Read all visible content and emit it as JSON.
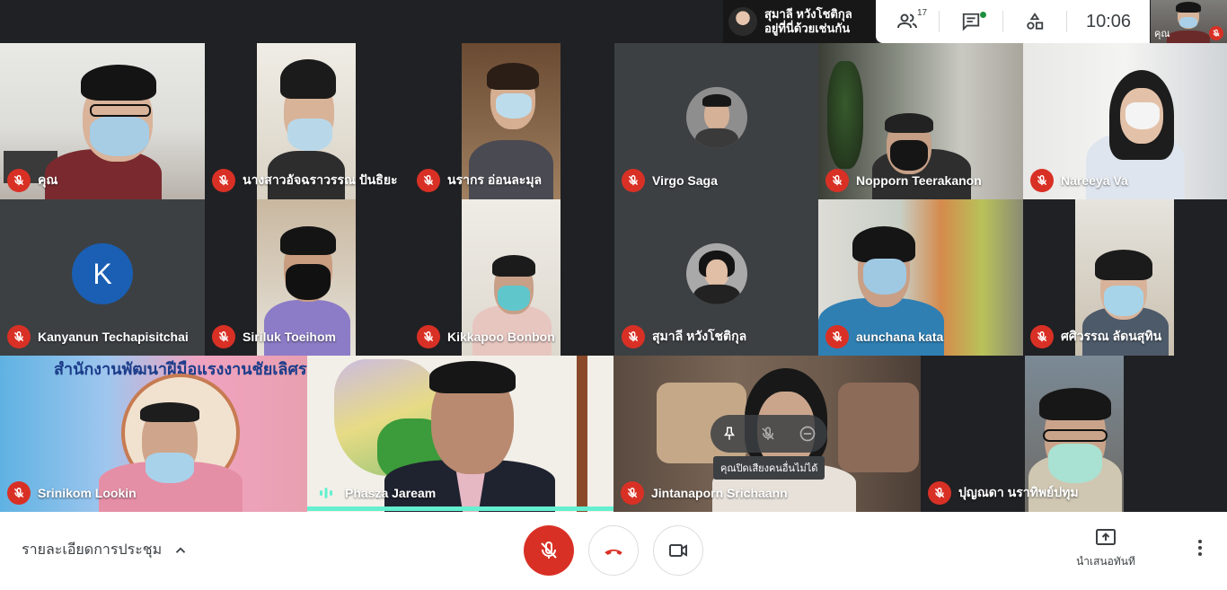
{
  "topbar": {
    "presenter_name": "สุมาลี หวังโชติกุล",
    "presenter_status": "อยู่ที่นี่ด้วยเช่นกัน",
    "participants_count": "17",
    "clock": "10:06",
    "self_label": "คุณ"
  },
  "tiles": [
    {
      "name": "คุณ"
    },
    {
      "name": "นางสาวอัจฉราวรรณ ปันธิยะ"
    },
    {
      "name": "นรากร อ่อนละมุล"
    },
    {
      "name": "Virgo Saga"
    },
    {
      "name": "Nopporn Teerakanon"
    },
    {
      "name": "Nareeya Va"
    },
    {
      "name": "Kanyanun Techapisitchai",
      "initial": "K"
    },
    {
      "name": "Siriluk Toeihom"
    },
    {
      "name": "Kikkapoo Bonbon"
    },
    {
      "name": "สุมาลี หวังโชติกุล"
    },
    {
      "name": "aunchana kata"
    },
    {
      "name": "ศศิวรรณ ลัดนสุทิน"
    },
    {
      "name": "Srinikom Lookin",
      "banner": "สำนักงานพัฒนาฝีมือแรงงานชัยเลิศร"
    },
    {
      "name": "Phasza Jaream"
    },
    {
      "name": "Jintanaporn Srichaann"
    },
    {
      "name": "ปุญณดา นราทิพย์ปทุม"
    }
  ],
  "hover_tooltip": "คุณปิดเสียงคนอื่นไม่ได้",
  "bottombar": {
    "meeting_details": "รายละเอียดการประชุม",
    "present_now": "นำเสนอทันที"
  },
  "colors": {
    "accent_red": "#d93025",
    "speaking": "#64f0d0",
    "avatar_blue": "#1a5fb4"
  }
}
